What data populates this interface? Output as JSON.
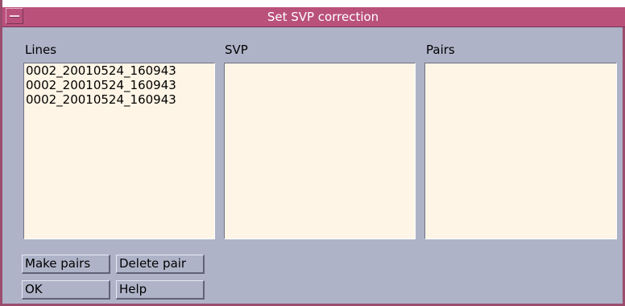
{
  "window": {
    "title": "Set SVP correction"
  },
  "columns": {
    "lines": {
      "label": "Lines",
      "items": [
        "0002_20010524_160943",
        "0002_20010524_160943",
        "0002_20010524_160943"
      ]
    },
    "svp": {
      "label": "SVP",
      "items": []
    },
    "pairs": {
      "label": "Pairs",
      "items": []
    }
  },
  "buttons": {
    "make_pairs": "Make pairs",
    "delete_pair": "Delete pair",
    "ok": "OK",
    "help": "Help"
  },
  "icons": {
    "window_menu": "window-menu-icon"
  },
  "colors": {
    "titlebar": "#b9517b",
    "window_background": "#afb3c8",
    "list_background": "#fff5e6"
  }
}
